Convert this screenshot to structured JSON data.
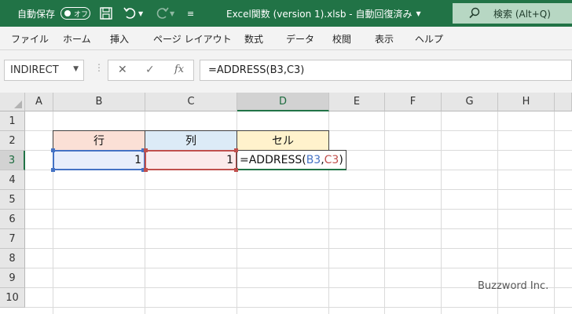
{
  "titlebar": {
    "autosave_label": "自動保存",
    "autosave_state": "オフ",
    "filename": "Excel関数 (version 1).xlsb - 自動回復済み",
    "search_label": "検索 (Alt+Q)"
  },
  "ribbon": {
    "tabs": [
      "ファイル",
      "ホーム",
      "挿入",
      "ページ レイアウト",
      "数式",
      "データ",
      "校閲",
      "表示",
      "ヘルプ"
    ]
  },
  "formula_bar": {
    "name_box": "INDIRECT",
    "cancel_glyph": "✕",
    "enter_glyph": "✓",
    "fx_glyph": "fx",
    "formula": "=ADDRESS(B3,C3)"
  },
  "sheet": {
    "columns": [
      "A",
      "B",
      "C",
      "D",
      "E",
      "F",
      "G",
      "H"
    ],
    "rows": [
      "1",
      "2",
      "3",
      "4",
      "5",
      "6",
      "7",
      "8",
      "9",
      "10"
    ],
    "selected_column": "D",
    "selected_row": "3",
    "headers": {
      "b2": "行",
      "c2": "列",
      "d2": "セル"
    },
    "values": {
      "b3": "1",
      "c3": "1"
    },
    "edit_formula": {
      "prefix": "=ADDRESS(",
      "ref1": "B3",
      "sep": ",",
      "ref2": "C3",
      "suffix": ")"
    },
    "header_fills": {
      "b2": "#fbe0d6",
      "c2": "#dcebf7",
      "d2": "#fff2cc"
    },
    "ref_colors": {
      "b3": "#4472c4",
      "c3": "#c0504d"
    }
  },
  "watermark": "Buzzword Inc."
}
